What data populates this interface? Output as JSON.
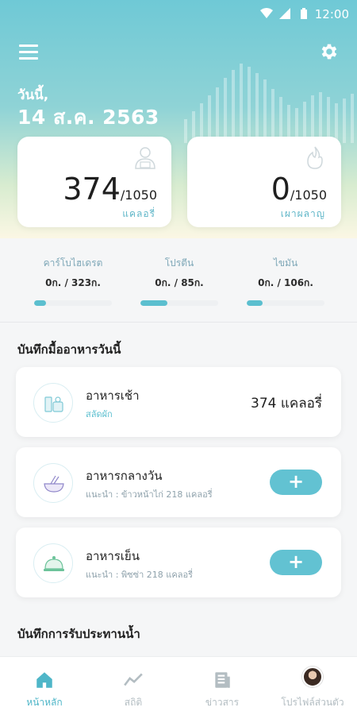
{
  "status_bar": {
    "time": "12:00"
  },
  "header": {
    "today_label": "วันนี้,",
    "date": "14 ส.ค. 2563"
  },
  "calories": {
    "consumed": {
      "value": "374",
      "goal": "/1050",
      "unit": "แคลอรี่",
      "icon": "person-icon"
    },
    "burned": {
      "value": "0",
      "goal": "/1050",
      "unit": "เผาผลาญ",
      "icon": "flame-icon"
    }
  },
  "nutrients": [
    {
      "name": "คาร์โบไฮเดรต",
      "amount": "0ก. / 323ก.",
      "progress": 0.15
    },
    {
      "name": "โปรตีน",
      "amount": "0ก. / 85ก.",
      "progress": 0.35
    },
    {
      "name": "ไขมัน",
      "amount": "0ก. / 106ก.",
      "progress": 0.2
    }
  ],
  "meals_section": {
    "title": "บันทึกมื้ออาหารวันนี้"
  },
  "meals": [
    {
      "title": "อาหารเช้า",
      "subtitle": "สลัดผัก",
      "kcal": "374 แคลอรี่",
      "icon": "breakfast-icon"
    },
    {
      "title": "อาหารกลางวัน",
      "subtitle": "แนะนำ : ข้าวหน้าไก่ 218 แคลอรี่",
      "add_label": "+",
      "icon": "lunch-bowl-icon"
    },
    {
      "title": "อาหารเย็น",
      "subtitle": "แนะนำ : พิซซ่า 218 แคลอรี่",
      "add_label": "+",
      "icon": "dinner-cloche-icon"
    }
  ],
  "water_section": {
    "title": "บันทึกการรับประทานน้ำ"
  },
  "bottom_nav": [
    {
      "label": "หน้าหลัก",
      "icon": "home-icon",
      "active": true
    },
    {
      "label": "สถิติ",
      "icon": "stats-icon",
      "active": false
    },
    {
      "label": "ข่าวสาร",
      "icon": "news-icon",
      "active": false
    },
    {
      "label": "โปรไฟล์ส่วนตัว",
      "icon": "avatar",
      "active": false
    }
  ],
  "colors": {
    "accent": "#5bbfcf",
    "header_top": "#6fc9d6",
    "header_bottom": "#fbf7e4"
  }
}
